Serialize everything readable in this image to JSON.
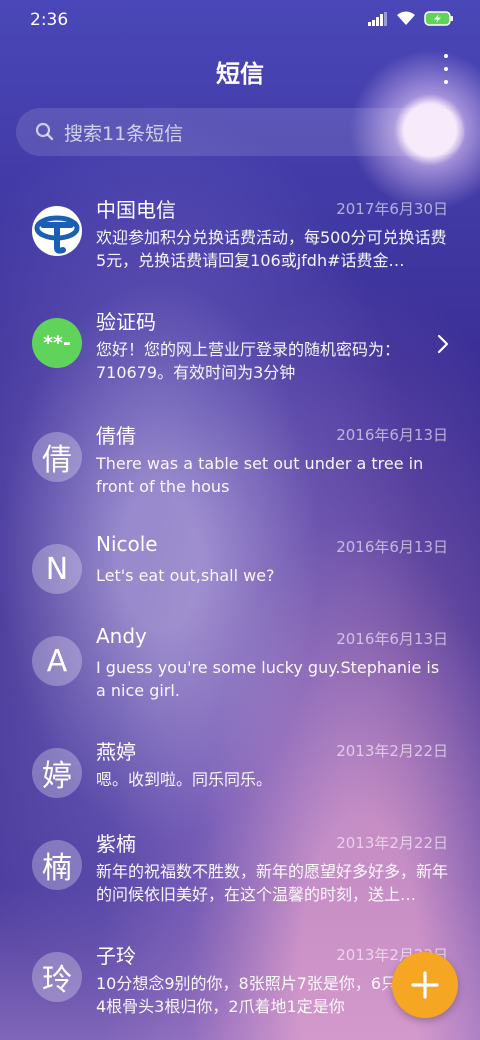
{
  "status_bar": {
    "time": "2:36"
  },
  "header": {
    "title": "短信"
  },
  "search": {
    "placeholder": "搜索11条短信"
  },
  "conversations": [
    {
      "sender": "中国电信",
      "date": "2017年6月30日",
      "avatar": "",
      "avatar_icon": "china-telecom-logo",
      "preview": "欢迎参加积分兑换话费活动，每500分可兑换话费5元，兑换话费请回复106或jfdh#话费金…"
    },
    {
      "sender": "验证码",
      "date": "",
      "avatar": "**-",
      "avatar_color": "#5fd35a",
      "preview": "您好！您的网上营业厅登录的随机密码为：710679。有效时间为3分钟"
    },
    {
      "sender": "倩倩",
      "date": "2016年6月13日",
      "avatar": "倩",
      "preview": "There was a table set out under a tree in front of the hous"
    },
    {
      "sender": "Nicole",
      "date": "2016年6月13日",
      "avatar": "N",
      "preview": "Let's eat out,shall we?"
    },
    {
      "sender": "Andy",
      "date": "2016年6月13日",
      "avatar": "A",
      "preview": "I guess you're some lucky guy.Stephanie is a nice girl."
    },
    {
      "sender": "燕婷",
      "date": "2013年2月22日",
      "avatar": "婷",
      "preview": "嗯。收到啦。同乐同乐。"
    },
    {
      "sender": "紫楠",
      "date": "2013年2月22日",
      "avatar": "楠",
      "preview": "新年的祝福数不胜数，新年的愿望好多好多，新年的问候依旧美好，在这个温馨的时刻，送上…"
    },
    {
      "sender": "子玲",
      "date": "2013年2月22日",
      "avatar": "玲",
      "preview": "10分想念9别的你，8张照片7张是你，6只像你，4根骨头3根归你，2爪着地1定是你"
    }
  ],
  "colors": {
    "fab": "#f5a623",
    "verify_avatar": "#5fd35a",
    "telecom_blue": "#1a5fb4"
  }
}
